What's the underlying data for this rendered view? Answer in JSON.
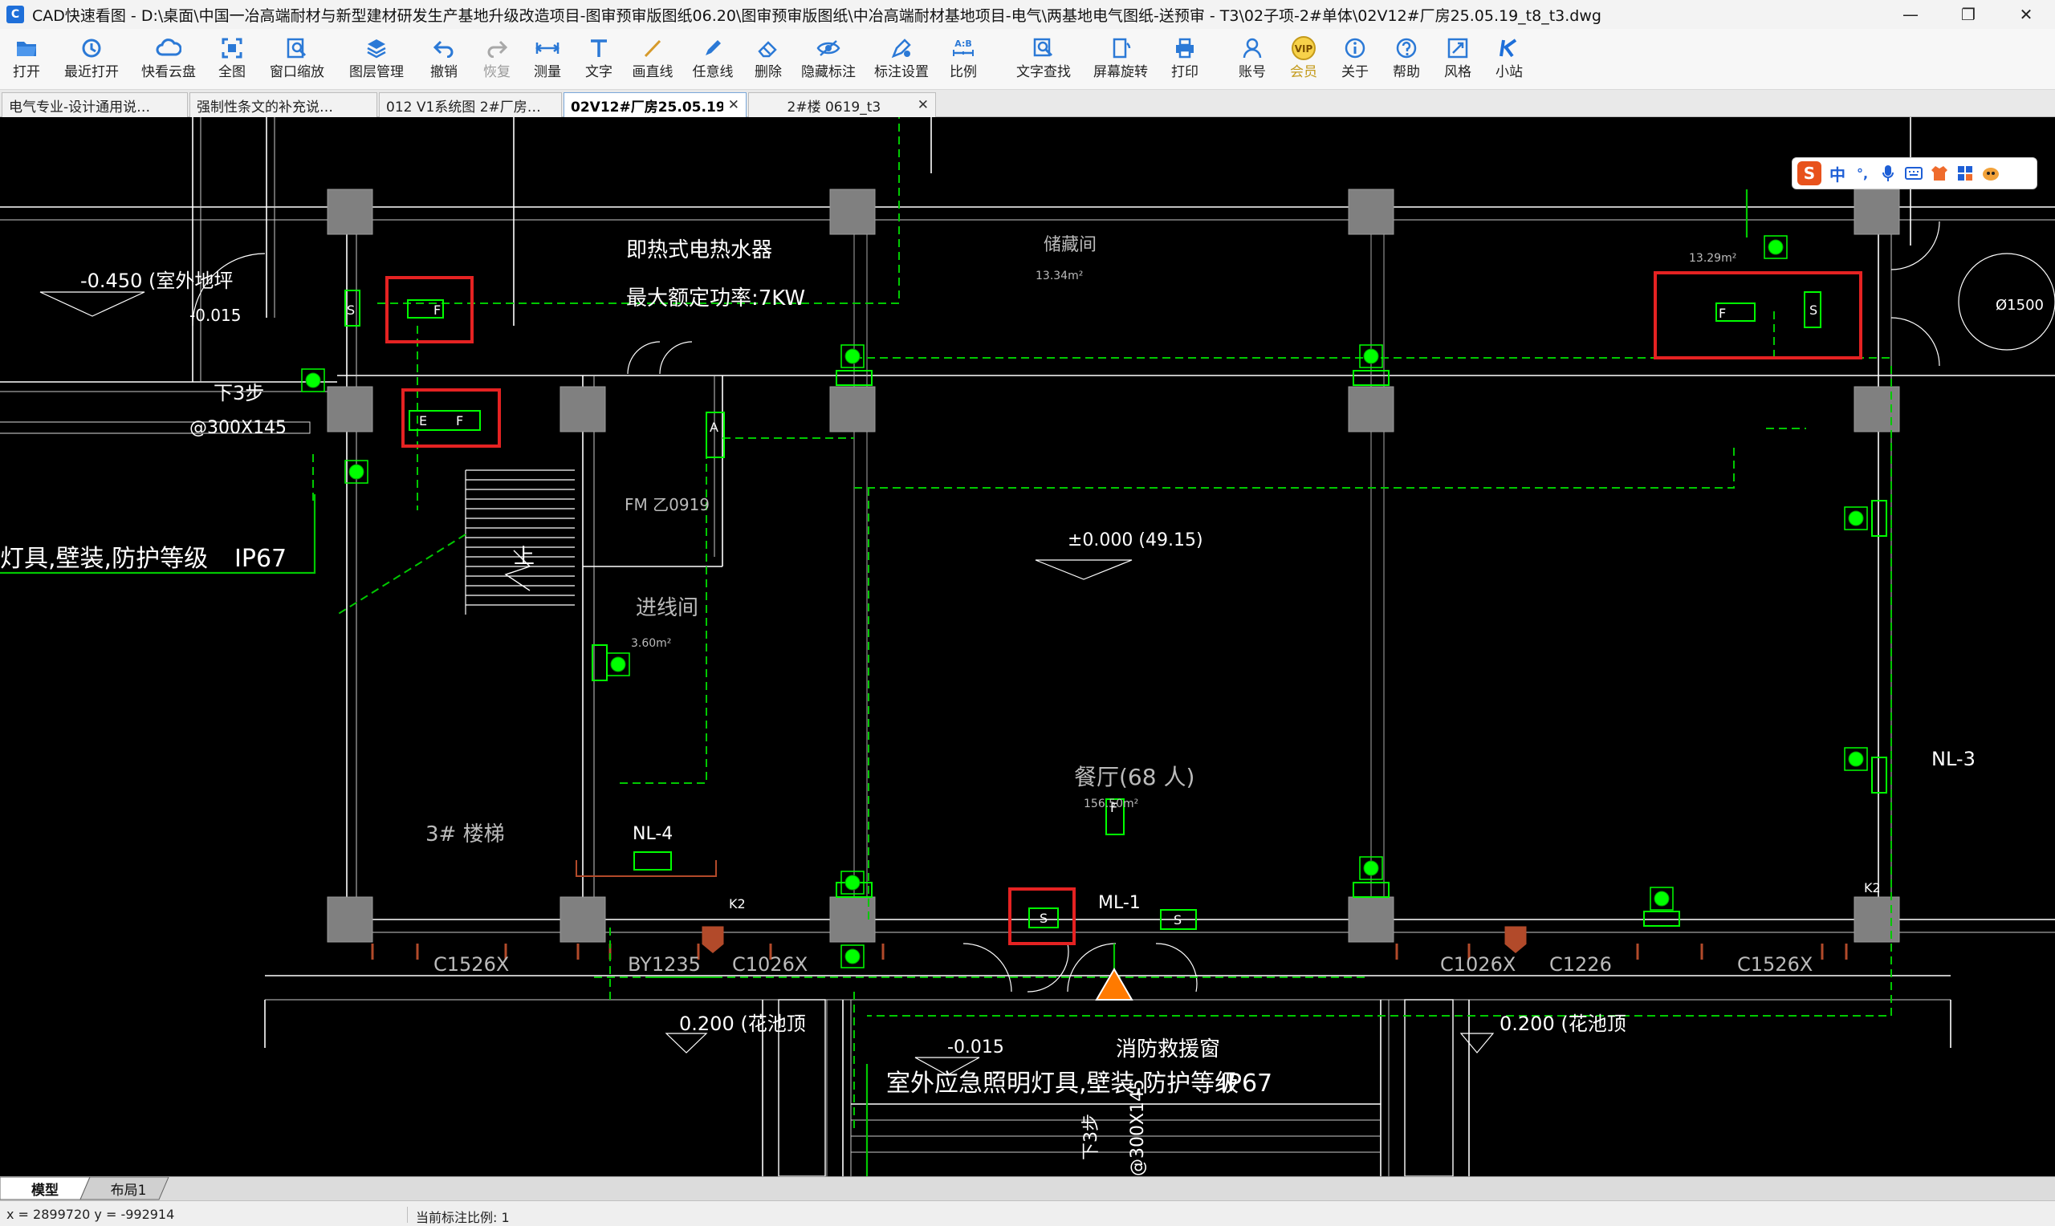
{
  "window": {
    "app_name": "CAD快速看图",
    "title": "CAD快速看图 - D:\\桌面\\中国一冶高端耐材与新型建材研发生产基地升级改造项目-图审预审版图纸06.20\\图审预审版图纸\\中冶高端耐材基地项目-电气\\两基地电气图纸-送预审 - T3\\02子项-2#单体\\02V12#厂房25.05.19_t8_t3.dwg",
    "minimize": "—",
    "maximize": "❐",
    "close": "✕"
  },
  "toolbar": {
    "items": [
      {
        "label": "打开",
        "icon": "folder-open-icon"
      },
      {
        "label": "最近打开",
        "icon": "history-icon"
      },
      {
        "label": "快看云盘",
        "icon": "cloud-icon"
      },
      {
        "label": "全图",
        "icon": "fit-all-icon"
      },
      {
        "label": "窗口缩放",
        "icon": "window-zoom-icon"
      },
      {
        "label": "图层管理",
        "icon": "layers-icon"
      },
      {
        "label": "撤销",
        "icon": "undo-icon"
      },
      {
        "label": "恢复",
        "icon": "redo-icon"
      },
      {
        "label": "测量",
        "icon": "measure-icon"
      },
      {
        "label": "文字",
        "icon": "text-icon"
      },
      {
        "label": "画直线",
        "icon": "line-icon"
      },
      {
        "label": "任意线",
        "icon": "freehand-icon"
      },
      {
        "label": "删除",
        "icon": "eraser-icon"
      },
      {
        "label": "隐藏标注",
        "icon": "eye-hide-icon"
      },
      {
        "label": "标注设置",
        "icon": "annotation-settings-icon"
      },
      {
        "label": "比例",
        "icon": "scale-icon"
      },
      {
        "label": "文字查找",
        "icon": "text-search-icon"
      },
      {
        "label": "屏幕旋转",
        "icon": "screen-rotate-icon"
      },
      {
        "label": "打印",
        "icon": "printer-icon"
      },
      {
        "label": "账号",
        "icon": "account-icon"
      },
      {
        "label": "会员",
        "icon": "vip-icon"
      },
      {
        "label": "关于",
        "icon": "info-icon"
      },
      {
        "label": "帮助",
        "icon": "help-icon"
      },
      {
        "label": "风格",
        "icon": "style-icon"
      },
      {
        "label": "小站",
        "icon": "k-station-icon"
      }
    ],
    "vip_badge": "VIP",
    "scale_badge": "A:B"
  },
  "tabs": [
    {
      "label": "电气专业-设计通用说…",
      "active": false
    },
    {
      "label": "强制性条文的补充说…",
      "active": false
    },
    {
      "label": "012 V1系统图 2#厂房…",
      "active": false
    },
    {
      "label": "02V12#厂房25.05.19_…",
      "active": true
    },
    {
      "label": "2#楼 0619_t3",
      "active": false
    }
  ],
  "tab_close": "✕",
  "ime": {
    "logo": "S",
    "mode": "中",
    "punct": "°,"
  },
  "drawing": {
    "texts": {
      "outdoor_ground": "-0.450  (室外地坪",
      "lvl_0015_a": "-0.015",
      "down3steps": "下3步",
      "size_300x145": "@300X145",
      "heater1": "即热式电热水器",
      "heater2": "最大额定功率:7KW",
      "stor_room": "储藏间",
      "area_1334": "13.34m²",
      "area_1329": "13.29m²",
      "lamp_note": "灯具,壁装,防护等级",
      "ip67": "IP67",
      "fm_door": "FM 乙0919",
      "cable_room": "进线间",
      "area_360": "3.60m²",
      "up": "上",
      "level_000": "±0.000  (49.15)",
      "dining": "餐厅(68 人)",
      "area_15650": "156.50m²",
      "stair3": "3# 楼梯",
      "nl3": "NL-3",
      "nl4": "NL-4",
      "ml1": "ML-1",
      "c1526x": "C1526X",
      "by1235": "BY1235",
      "c1026x": "C1026X",
      "c1226": "C1226",
      "lvl_0200": "0.200  (花池顶",
      "lvl_0015_b": "-0.015",
      "fire_window": "消防救援窗",
      "outdoor_lamp": "室外应急照明灯具,壁装,防护等级",
      "size_300x145_v": "@300X145",
      "down3steps_v": "下3步",
      "k2": "K2",
      "dia": "Ø1500",
      "lamp_f": "F",
      "lamp_e": "E",
      "lamp_s": "S",
      "lamp_a": "A"
    }
  },
  "layout_tabs": [
    {
      "label": "模型",
      "active": true
    },
    {
      "label": "布局1",
      "active": false
    }
  ],
  "status": {
    "coords": "x = 2899720  y = -992914",
    "annotation_scale": "当前标注比例: 1"
  },
  "colors": {
    "cad_background": "#000000",
    "wall": "#ffffff",
    "column": "#808080",
    "circuit": "#00c800",
    "fixture": "#00ff00",
    "highlight_box": "#e52222",
    "window_frame": "#b24a2a"
  }
}
